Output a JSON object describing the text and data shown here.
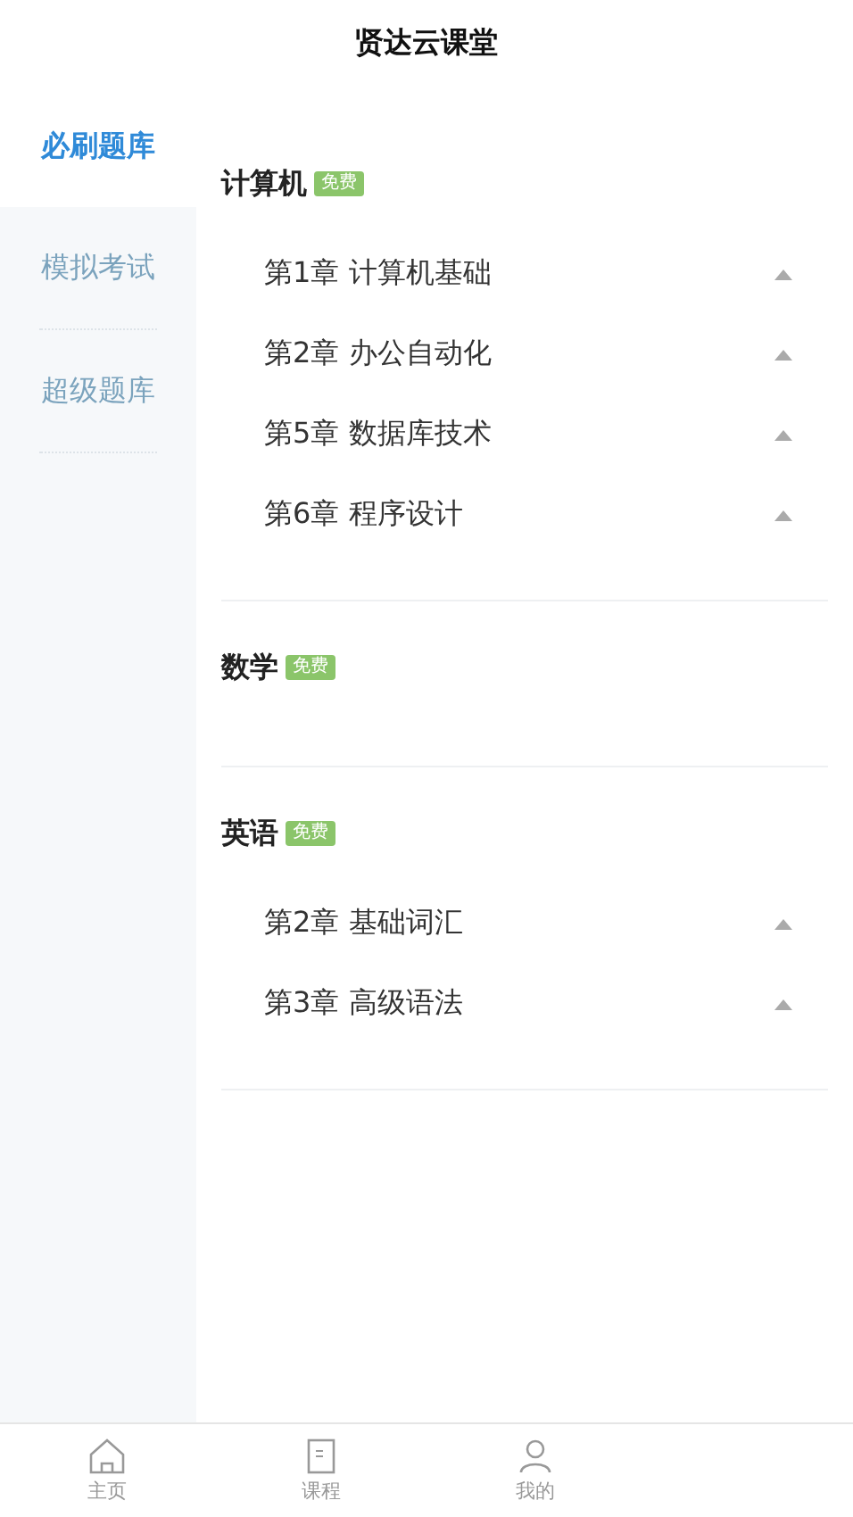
{
  "header": {
    "title": "贤达云课堂"
  },
  "sidebar": {
    "items": [
      {
        "label": "必刷题库",
        "selected": true
      },
      {
        "label": "模拟考试",
        "selected": false
      },
      {
        "label": "超级题库",
        "selected": false
      }
    ]
  },
  "subjects": [
    {
      "name": "计算机",
      "badge": "免费",
      "chapters": [
        {
          "title": "第1章 计算机基础",
          "expanded": true
        },
        {
          "title": "第2章 办公自动化",
          "expanded": true
        },
        {
          "title": "第5章 数据库技术",
          "expanded": true
        },
        {
          "title": "第6章 程序设计",
          "expanded": true
        }
      ]
    },
    {
      "name": "数学",
      "badge": "免费"
    },
    {
      "name": "英语",
      "badge": "免费",
      "chapters": [
        {
          "title": "第2章 基础词汇",
          "expanded": true
        },
        {
          "title": "第3章 高级语法",
          "expanded": true
        }
      ]
    }
  ],
  "tab_bar": {
    "tabs": [
      {
        "kind": "home",
        "label": "主页",
        "selected": false
      },
      {
        "kind": "course",
        "label": "课程",
        "selected": false
      },
      {
        "kind": "profile",
        "label": "我的",
        "selected": false
      }
    ]
  }
}
